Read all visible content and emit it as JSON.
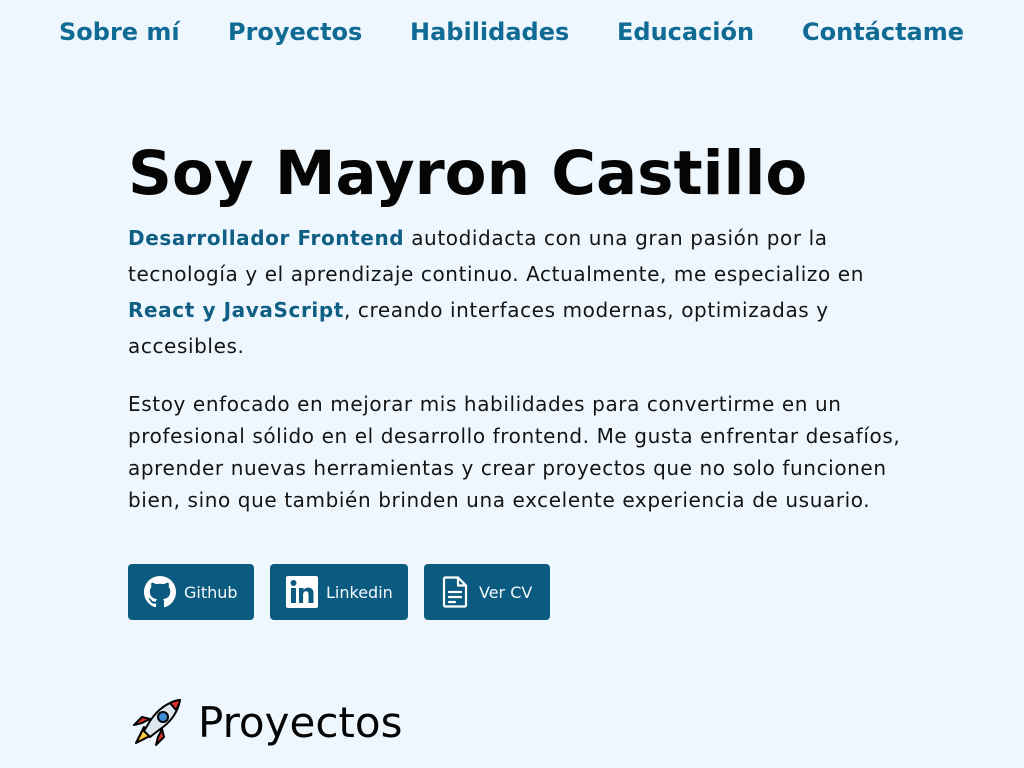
{
  "nav": {
    "items": [
      {
        "label": "Sobre mí"
      },
      {
        "label": "Proyectos"
      },
      {
        "label": "Habilidades"
      },
      {
        "label": "Educación"
      },
      {
        "label": "Contáctame"
      }
    ]
  },
  "hero": {
    "title": "Soy Mayron Castillo",
    "intro": {
      "highlight_1": "Desarrollador Frontend",
      "text_1": " autodidacta con una gran pasión por la tecnología y el aprendizaje continuo. Actualmente, me especializo en ",
      "highlight_2": "React y JavaScript",
      "text_2": ", creando interfaces modernas, optimizadas y accesibles."
    },
    "about": "Estoy enfocado en mejorar mis habilidades para convertirme en un profesional sólido en el desarrollo frontend. Me gusta enfrentar desafíos, aprender nuevas herramientas y crear proyectos que no solo funcionen bien, sino que también brinden una excelente experiencia de usuario."
  },
  "socials": {
    "github_label": "Github",
    "linkedin_label": "Linkedin",
    "cv_label": "Ver CV"
  },
  "projects": {
    "title": "Proyectos"
  },
  "colors": {
    "background": "#eff7fe",
    "nav_link": "#0f6a94",
    "highlight": "#0f5f84",
    "button_bg": "#0b5b80"
  },
  "icons": {
    "github": "github-icon",
    "linkedin": "linkedin-icon",
    "cv": "document-icon",
    "projects": "rocket-icon"
  }
}
